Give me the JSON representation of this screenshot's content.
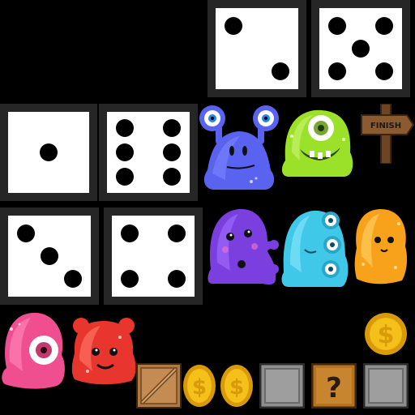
{
  "sheet": {
    "background": "#000000",
    "dice": [
      {
        "name": "die-face-2",
        "value": 2
      },
      {
        "name": "die-face-5",
        "value": 5
      },
      {
        "name": "die-face-1",
        "value": 1
      },
      {
        "name": "die-face-6",
        "value": 6
      },
      {
        "name": "die-face-3",
        "value": 3
      },
      {
        "name": "die-face-4",
        "value": 4
      }
    ],
    "finish_sign": {
      "label": "FINISH",
      "icon": "signpost-icon"
    },
    "question_block": {
      "label": "?",
      "icon": "question-block-icon"
    },
    "coin": {
      "label": "$",
      "icon": "coin-icon"
    },
    "colors": {
      "blue": "#5a63f0",
      "green": "#9be12a",
      "purple": "#7b3fe0",
      "cyan": "#3fc8e8",
      "orange": "#f7a21a",
      "pink": "#ef4f8e",
      "red": "#e8352e",
      "gold": "#f5c01a",
      "crate": "#b07a43",
      "stone": "#8f8f8f"
    }
  }
}
